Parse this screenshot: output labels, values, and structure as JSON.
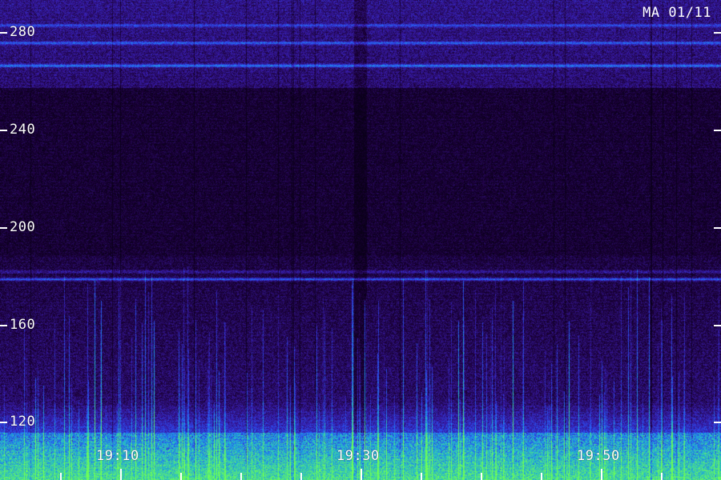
{
  "stamp": "MA 01/11",
  "y_axis": {
    "unit_min": 102,
    "unit_max": 293,
    "ticks": [
      {
        "value": 280,
        "label": "280"
      },
      {
        "value": 240,
        "label": "240"
      },
      {
        "value": 200,
        "label": "200"
      },
      {
        "value": 160,
        "label": "160"
      },
      {
        "value": 120,
        "label": "120"
      }
    ]
  },
  "x_axis": {
    "labels": [
      {
        "label": "19:10"
      },
      {
        "label": "19:30"
      },
      {
        "label": "19:50"
      }
    ]
  },
  "colors": {
    "background": "#000000",
    "low": "#1a0033",
    "mid": "#3a1ca8",
    "high": "#2f6cff",
    "peak": "#2bd9c0",
    "hot": "#6cff5a",
    "text": "#ffffff"
  },
  "bands": [
    {
      "value": 283,
      "strength": 0.55
    },
    {
      "value": 276,
      "strength": 0.7
    },
    {
      "value": 267,
      "strength": 0.85
    },
    {
      "value": 182,
      "strength": 0.9
    },
    {
      "value": 185,
      "strength": 0.45
    }
  ]
}
